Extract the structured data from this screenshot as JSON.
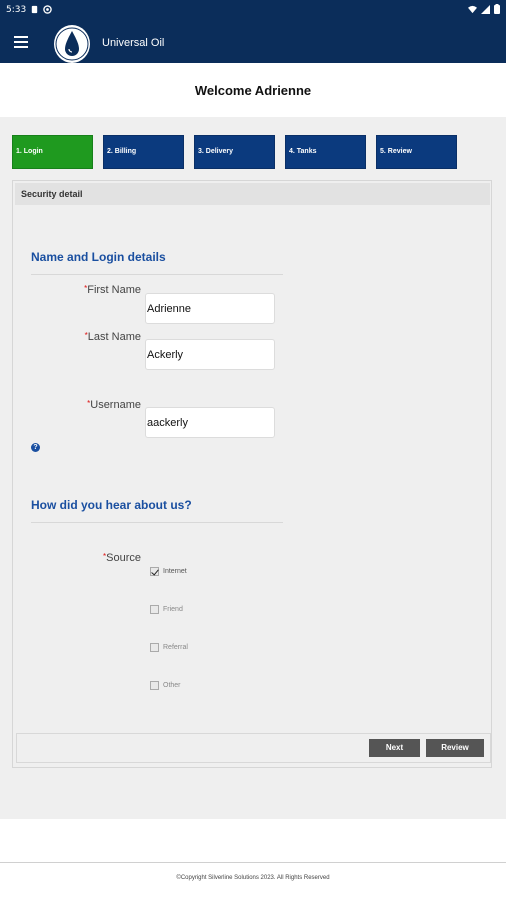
{
  "status": {
    "time": "5:33"
  },
  "app": {
    "title": "Universal Oil"
  },
  "welcome": "Welcome Adrienne",
  "steps": [
    {
      "label": "1. Login"
    },
    {
      "label": "2. Billing"
    },
    {
      "label": "3. Delivery"
    },
    {
      "label": "4. Tanks"
    },
    {
      "label": "5. Review"
    }
  ],
  "panel": {
    "header": "Security detail"
  },
  "name_section": {
    "title": "Name and Login details",
    "first_name_label": "First Name",
    "first_name_value": "Adrienne",
    "last_name_label": "Last Name",
    "last_name_value": "Ackerly",
    "username_label": "Username",
    "username_value": "aackerly",
    "help_icon": "?"
  },
  "hear_section": {
    "title": "How did you hear about us?",
    "source_label": "Source",
    "options": [
      {
        "label": "Internet",
        "checked": true
      },
      {
        "label": "Friend",
        "checked": false
      },
      {
        "label": "Referral",
        "checked": false
      },
      {
        "label": "Other",
        "checked": false
      }
    ]
  },
  "buttons": {
    "next": "Next",
    "review": "Review"
  },
  "footer": "©Copyright Silverline Solutions 2023. All Rights Reserved",
  "colors": {
    "appbar": "#0b2d5a",
    "step": "#0b3a7e",
    "step_active": "#1f9a1f",
    "section_title": "#1a4fa0"
  }
}
